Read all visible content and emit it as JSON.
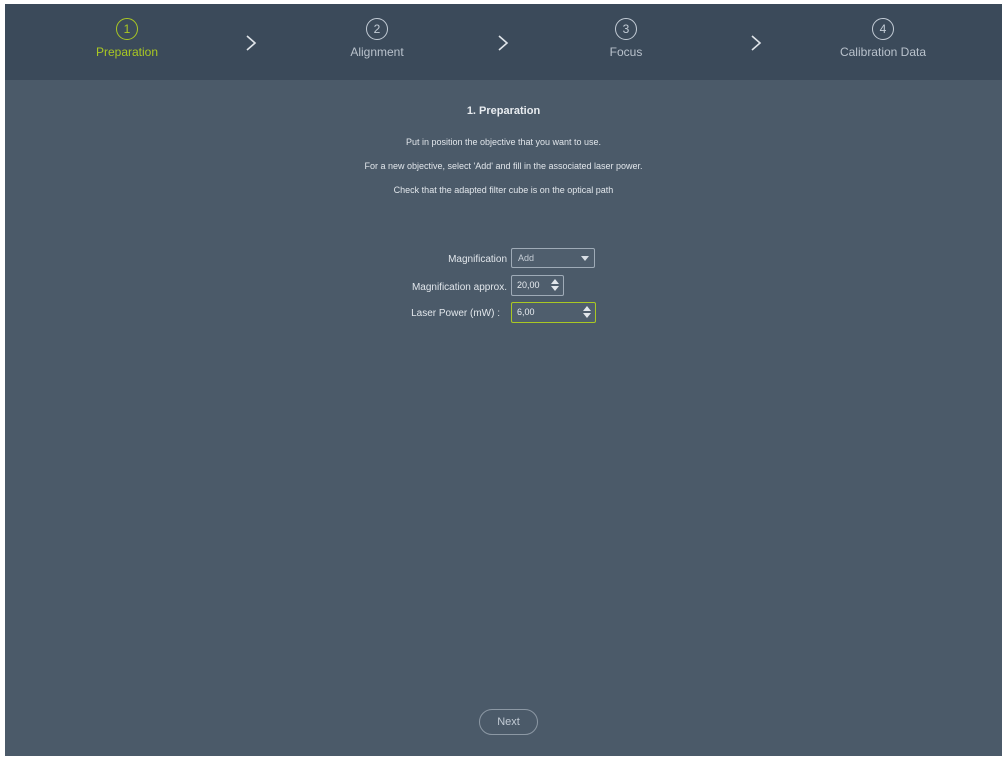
{
  "stepper": {
    "steps": [
      {
        "number": "1",
        "label": "Preparation",
        "active": true
      },
      {
        "number": "2",
        "label": "Alignment",
        "active": false
      },
      {
        "number": "3",
        "label": "Focus",
        "active": false
      },
      {
        "number": "4",
        "label": "Calibration Data",
        "active": false
      }
    ],
    "separator_icon": "chevron-right-icon"
  },
  "content": {
    "title": "1. Preparation",
    "instructions": [
      "Put in position the objective that you want to use.",
      "For a new objective, select 'Add' and fill in the associated laser power.",
      "Check that the adapted filter cube is on the optical path"
    ]
  },
  "form": {
    "magnification": {
      "label": "Magnification",
      "value": "Add"
    },
    "magnification_approx": {
      "label": "Magnification approx.",
      "value": "20,00"
    },
    "laser_power": {
      "label": "Laser Power (mW) :",
      "value": "6,00"
    }
  },
  "footer": {
    "next_label": "Next"
  },
  "colors": {
    "accent": "#aac823",
    "header_bg": "#3b4a5a",
    "panel_bg": "#4b5a69",
    "text": "#e1e6eb"
  }
}
